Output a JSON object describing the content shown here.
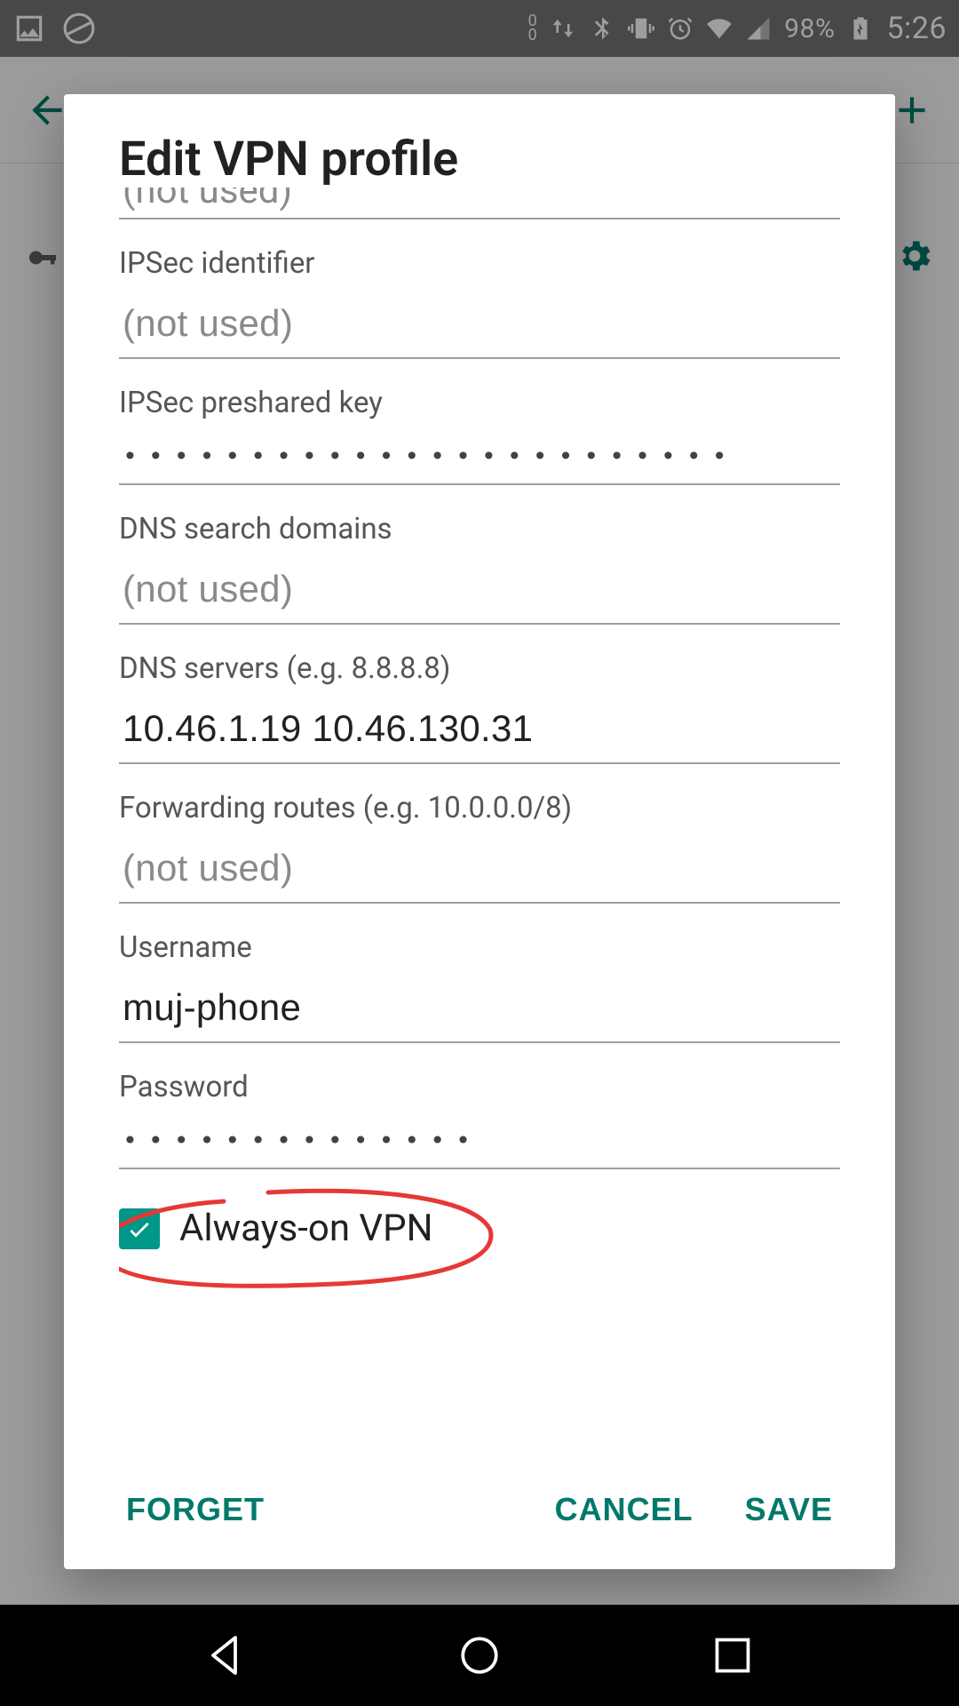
{
  "status": {
    "battery_text": "98%",
    "clock_text": "5:26",
    "net_badge": "0\n0"
  },
  "dialog": {
    "title": "Edit VPN profile",
    "cutoff_placeholder": "(not used)",
    "fields": {
      "ipsec_identifier": {
        "label": "IPSec identifier",
        "placeholder": "(not used)",
        "value": ""
      },
      "ipsec_psk": {
        "label": "IPSec preshared key",
        "value": "••••••••••••••••••••••••"
      },
      "dns_search": {
        "label": "DNS search domains",
        "placeholder": "(not used)",
        "value": ""
      },
      "dns_servers": {
        "label": "DNS servers (e.g. 8.8.8.8)",
        "value": "10.46.1.19 10.46.130.31"
      },
      "fwd_routes": {
        "label": "Forwarding routes (e.g. 10.0.0.0/8)",
        "placeholder": "(not used)",
        "value": ""
      },
      "username": {
        "label": "Username",
        "value": "muj-phone"
      },
      "password": {
        "label": "Password",
        "value": "••••••••••••••"
      }
    },
    "always_on": {
      "label": "Always-on VPN",
      "checked": true
    },
    "buttons": {
      "forget": "FORGET",
      "cancel": "CANCEL",
      "save": "SAVE"
    }
  },
  "colors": {
    "accent": "#009688",
    "accent_dark": "#00796b",
    "annotation": "#e53935"
  }
}
